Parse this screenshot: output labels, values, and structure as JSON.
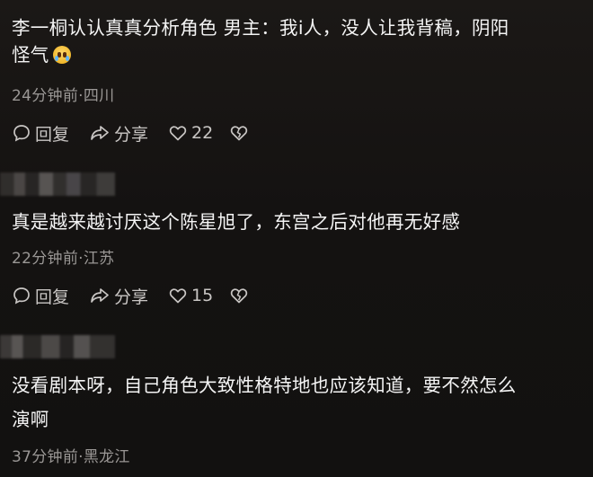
{
  "comments": [
    {
      "text_line1": "李一桐认认真真分析角色   男主：我i人，没人让我背稿，阴阳",
      "text_line2": "怪气",
      "emoji": "crying-face-icon",
      "meta": "24分钟前·四川",
      "reply_label": "回复",
      "share_label": "分享",
      "likes": "22"
    },
    {
      "text_line1": "真是越来越讨厌这个陈星旭了，东宫之后对他再无好感",
      "meta": "22分钟前·江苏",
      "reply_label": "回复",
      "share_label": "分享",
      "likes": "15"
    },
    {
      "text_line1": "没看剧本呀，自己角色大致性格特地也应该知道，要不然怎么",
      "text_line2": "演啊",
      "meta": "37分钟前·黑龙江"
    }
  ],
  "colors": {
    "background": "#141211",
    "text": "#f4f4f4",
    "meta": "#9a9795",
    "actions": "#c9c6c4"
  }
}
